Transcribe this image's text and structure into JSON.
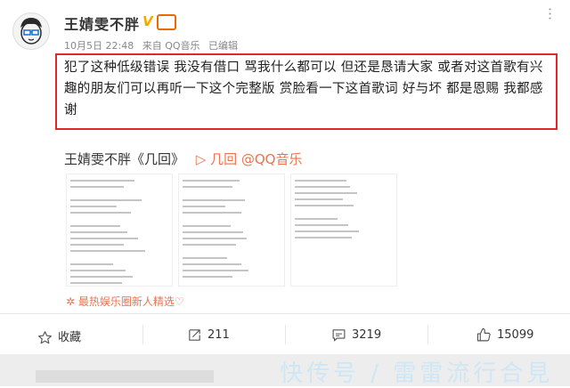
{
  "post": {
    "username": "王婧雯不胖",
    "verified_badge": "V",
    "meta": {
      "date": "10月5日 22:48",
      "source": "来自 QQ音乐",
      "edited": "已编辑"
    },
    "text": "犯了这种低级错误 我没有借口 骂我什么都可以  但还是恳请大家 或者对这首歌有兴趣的朋友们可以再听一下这个完整版 赏脸看一下这首歌词 好与坏 都是恩赐 我都感谢",
    "song": {
      "title": "王婧雯不胖《几回》",
      "link_label": "▷ 几回 @QQ音乐"
    },
    "promo": "最热娱乐圈新人精选♡"
  },
  "actions": {
    "favorite_label": "收藏",
    "repost_count": "211",
    "comment_count": "3219",
    "like_count": "15099"
  },
  "watermark": "快传号 / 雷雷流行合見"
}
